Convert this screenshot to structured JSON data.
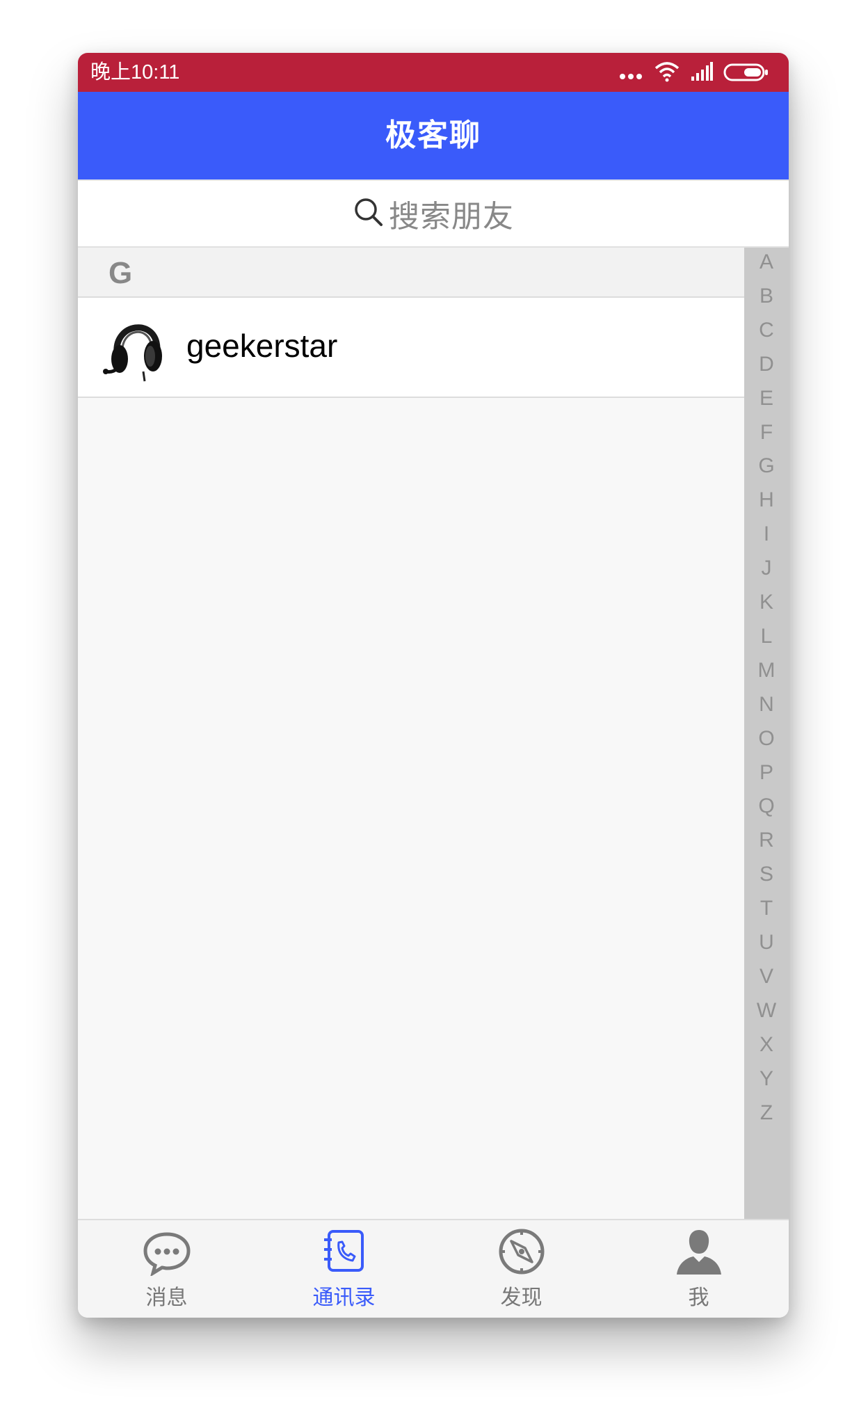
{
  "status_bar": {
    "time": "晚上10:11"
  },
  "header": {
    "title": "极客聊"
  },
  "search": {
    "placeholder": "搜索朋友"
  },
  "contacts": {
    "section": "G",
    "items": [
      {
        "name": "geekerstar",
        "avatar_icon": "headphones-icon"
      }
    ]
  },
  "index_bar": {
    "letters": [
      "A",
      "B",
      "C",
      "D",
      "E",
      "F",
      "G",
      "H",
      "I",
      "J",
      "K",
      "L",
      "M",
      "N",
      "O",
      "P",
      "Q",
      "R",
      "S",
      "T",
      "U",
      "V",
      "W",
      "X",
      "Y",
      "Z"
    ]
  },
  "tab_bar": {
    "tabs": [
      {
        "label": "消息",
        "icon": "chat-bubble-icon",
        "active": false
      },
      {
        "label": "通讯录",
        "icon": "contacts-book-icon",
        "active": true
      },
      {
        "label": "发现",
        "icon": "compass-icon",
        "active": false
      },
      {
        "label": "我",
        "icon": "person-icon",
        "active": false
      }
    ]
  },
  "colors": {
    "status_bar": "#b9203a",
    "nav_bar": "#3a5bfa",
    "active_tab": "#3a5bfa"
  }
}
